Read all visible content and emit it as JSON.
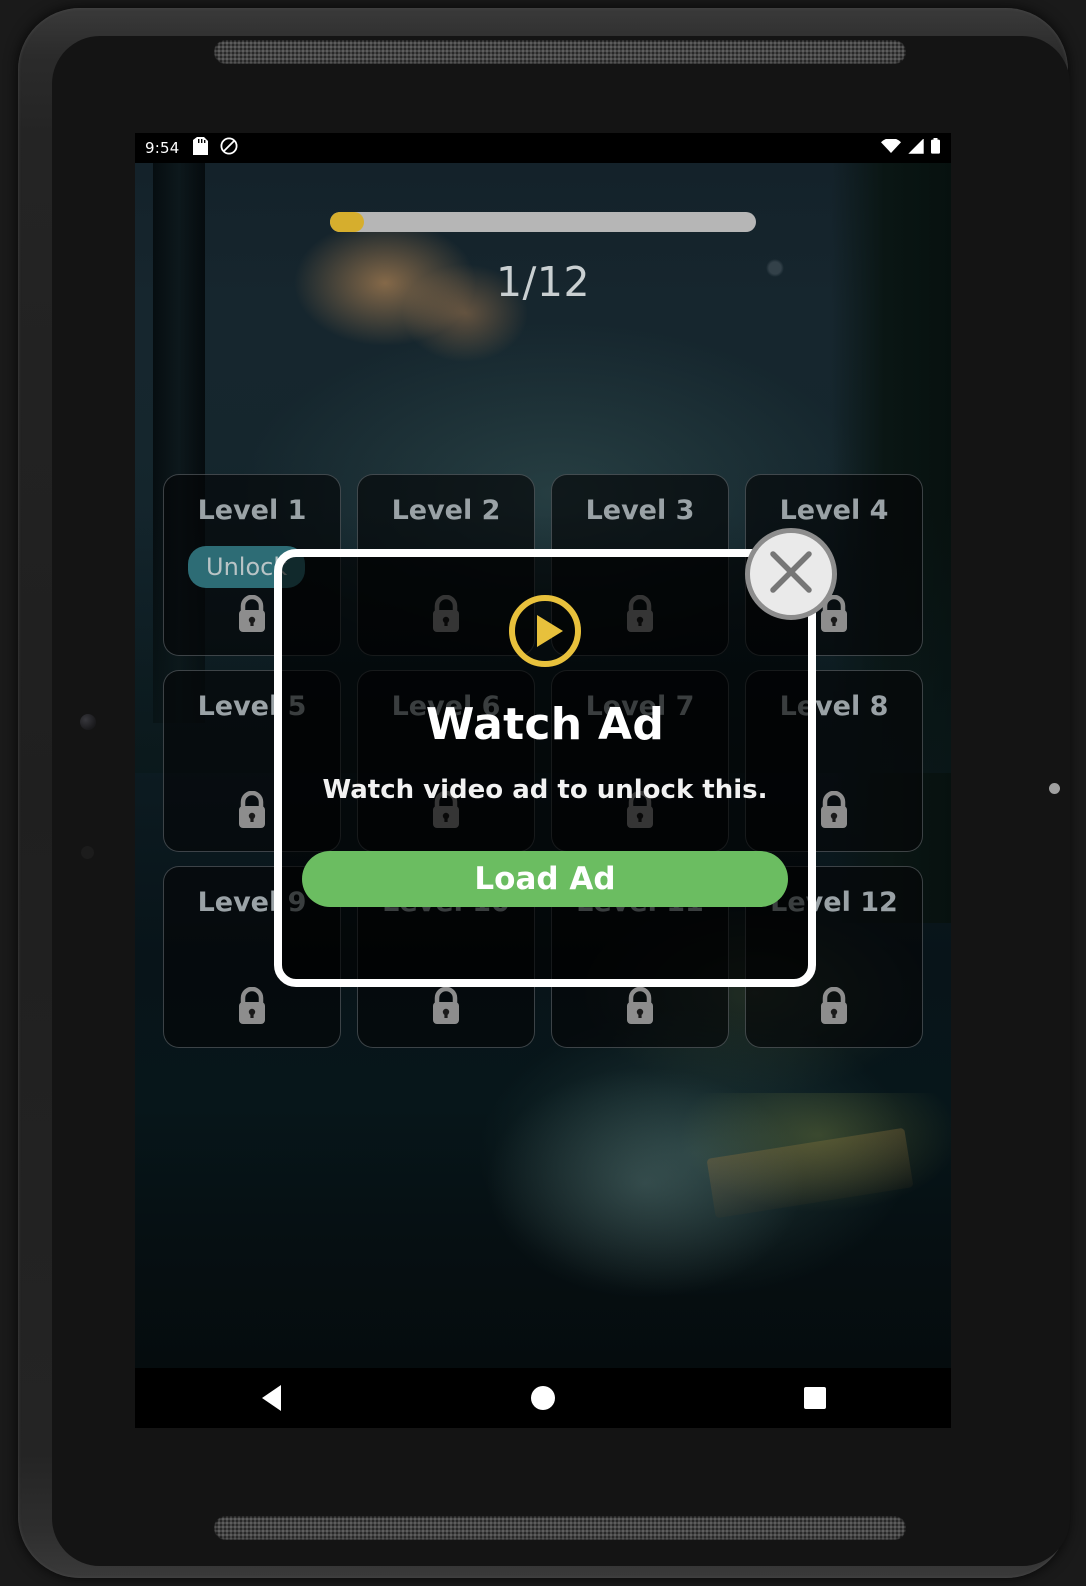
{
  "status_bar": {
    "clock": "9:54",
    "left_icons": [
      "sd-card-icon",
      "do-not-disturb-icon"
    ],
    "right_icons": [
      "wifi-icon",
      "cell-signal-icon",
      "battery-icon"
    ]
  },
  "header": {
    "progress_label": "1/12",
    "progress_percent": 8,
    "progress_fill_color": "#d6ae2d",
    "progress_track_color": "#b6b6b6"
  },
  "levels": [
    {
      "title": "Level 1",
      "unlock_label": "Unlock",
      "locked": true
    },
    {
      "title": "Level 2",
      "unlock_label": "",
      "locked": true
    },
    {
      "title": "Level 3",
      "unlock_label": "",
      "locked": true
    },
    {
      "title": "Level 4",
      "unlock_label": "",
      "locked": true
    },
    {
      "title": "Level 5",
      "unlock_label": "",
      "locked": true
    },
    {
      "title": "Level 6",
      "unlock_label": "",
      "locked": true
    },
    {
      "title": "Level 7",
      "unlock_label": "",
      "locked": true
    },
    {
      "title": "Level 8",
      "unlock_label": "",
      "locked": true
    },
    {
      "title": "Level 9",
      "unlock_label": "",
      "locked": true
    },
    {
      "title": "Level 10",
      "unlock_label": "",
      "locked": true
    },
    {
      "title": "Level 11",
      "unlock_label": "",
      "locked": true
    },
    {
      "title": "Level 12",
      "unlock_label": "",
      "locked": true
    }
  ],
  "dialog": {
    "play_icon": "play-circle-icon",
    "title": "Watch Ad",
    "subtitle": "Watch video ad to unlock this.",
    "button_label": "Load Ad",
    "button_color": "#6bbd61",
    "border_color": "#ffffff",
    "close_icon": "close-icon"
  },
  "nav_bar": {
    "back": "back-icon",
    "home": "home-icon",
    "recents": "recents-icon"
  },
  "colors": {
    "accent_yellow": "#e8c13c",
    "accent_teal": "#2d6c75",
    "accent_green": "#6bbd61",
    "level_text": "#9aa2a6"
  }
}
